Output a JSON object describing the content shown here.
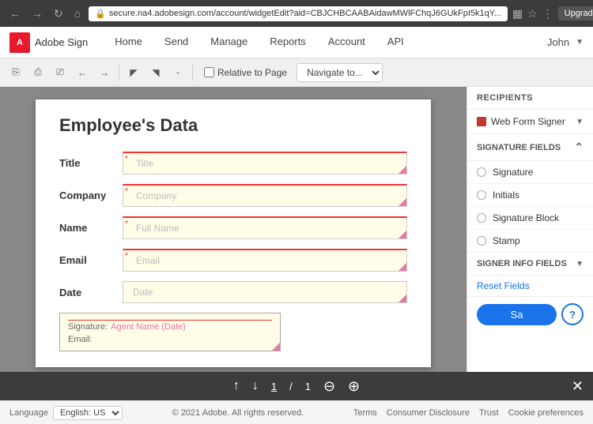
{
  "browser": {
    "address": "secure.na4.adobesign.com/account/widgetEdit?aid=CBJCHBCAABAidawMWlFChqJ6GUkFpI5k1qY...",
    "upgrade_label": "Upgrade"
  },
  "header": {
    "logo_text": "A",
    "app_name": "Adobe Sign",
    "nav": [
      "Home",
      "Send",
      "Manage",
      "Reports",
      "Account",
      "API"
    ],
    "user": "John"
  },
  "toolbar": {
    "relative_label": "Relative to Page",
    "navigate_placeholder": "Navigate to...",
    "navigate_options": [
      "Navigate to..."
    ]
  },
  "document": {
    "title": "Employee's Data",
    "fields": [
      {
        "label": "Title",
        "placeholder": "Title"
      },
      {
        "label": "Company",
        "placeholder": "Company"
      },
      {
        "label": "Name",
        "placeholder": "Full Name"
      },
      {
        "label": "Email",
        "placeholder": "Email"
      },
      {
        "label": "Date",
        "placeholder": "Date"
      }
    ],
    "signature_block": {
      "label": "Signature:",
      "value": "Agent Name (Date)",
      "email_label": "Email:"
    }
  },
  "right_panel": {
    "recipients_label": "RECIPIENTS",
    "web_form_signer_label": "Web Form Signer",
    "signature_fields_label": "Signature Fields",
    "fields": [
      "Signature",
      "Initials",
      "Signature Block",
      "Stamp"
    ],
    "signer_info_label": "Signer Info Fields",
    "reset_label": "Reset Fields",
    "save_label": "Sa"
  },
  "bottom_bar": {
    "page_current": "1",
    "page_total": "1"
  },
  "status_bar": {
    "language_label": "Language",
    "language_value": "English: US",
    "copyright": "© 2021 Adobe. All rights reserved.",
    "links": [
      "Terms",
      "Consumer Disclosure",
      "Trust",
      "Cookie preferences"
    ]
  }
}
